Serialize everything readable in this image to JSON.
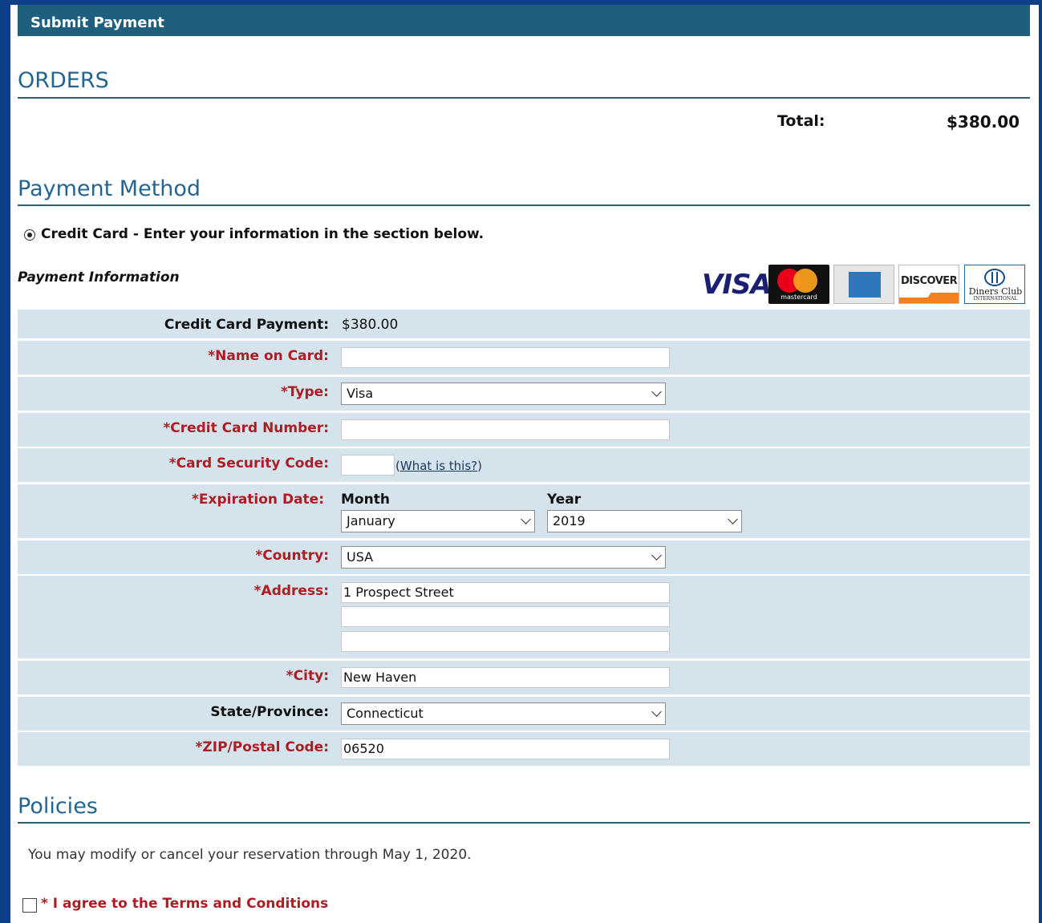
{
  "header": {
    "title": "Submit Payment"
  },
  "orders": {
    "title": "ORDERS",
    "total_label": "Total:",
    "total_value": "$380.00"
  },
  "payment_method": {
    "title": "Payment Method",
    "credit_card_option": "Credit Card - Enter your information in the section below.",
    "credit_card_selected": true
  },
  "payment_info": {
    "heading": "Payment Information",
    "card_logos": [
      "visa-logo",
      "mastercard-logo",
      "amex-logo",
      "discover-logo",
      "diners-club-logo"
    ],
    "visa_text": "VISA",
    "mastercard_text": "mastercard",
    "discover_text": "DISCOVER",
    "diners_text": "Diners Club",
    "diners_subtext": "INTERNATIONAL"
  },
  "form": {
    "payment": {
      "label": "Credit Card Payment:",
      "value": "$380.00"
    },
    "name": {
      "label": "*Name on Card:",
      "value": ""
    },
    "type": {
      "label": "*Type:",
      "value": "Visa"
    },
    "number": {
      "label": "*Credit Card Number:",
      "value": ""
    },
    "security": {
      "label": "*Card Security Code:",
      "value": "",
      "help_link": "What is this?"
    },
    "expiration": {
      "label": "*Expiration Date:",
      "month_label": "Month",
      "month_value": "January",
      "year_label": "Year",
      "year_value": "2019"
    },
    "country": {
      "label": "*Country:",
      "value": "USA"
    },
    "address": {
      "label": "*Address:",
      "line1": "1 Prospect Street",
      "line2": "",
      "line3": ""
    },
    "city": {
      "label": "*City:",
      "value": "New Haven"
    },
    "state": {
      "label": "State/Province:",
      "value": "Connecticut"
    },
    "zip": {
      "label": "*ZIP/Postal Code:",
      "value": "06520"
    }
  },
  "policies": {
    "title": "Policies",
    "text": "You may modify or cancel your reservation through May 1, 2020.",
    "agree_label": "* I agree to the Terms and Conditions",
    "agree_checked": false
  },
  "colors": {
    "frame": "#0d3f86",
    "header_bar": "#1f5f7e",
    "section_title": "#236591",
    "form_row": "#d4e3ec",
    "required_label": "#b01c23"
  }
}
